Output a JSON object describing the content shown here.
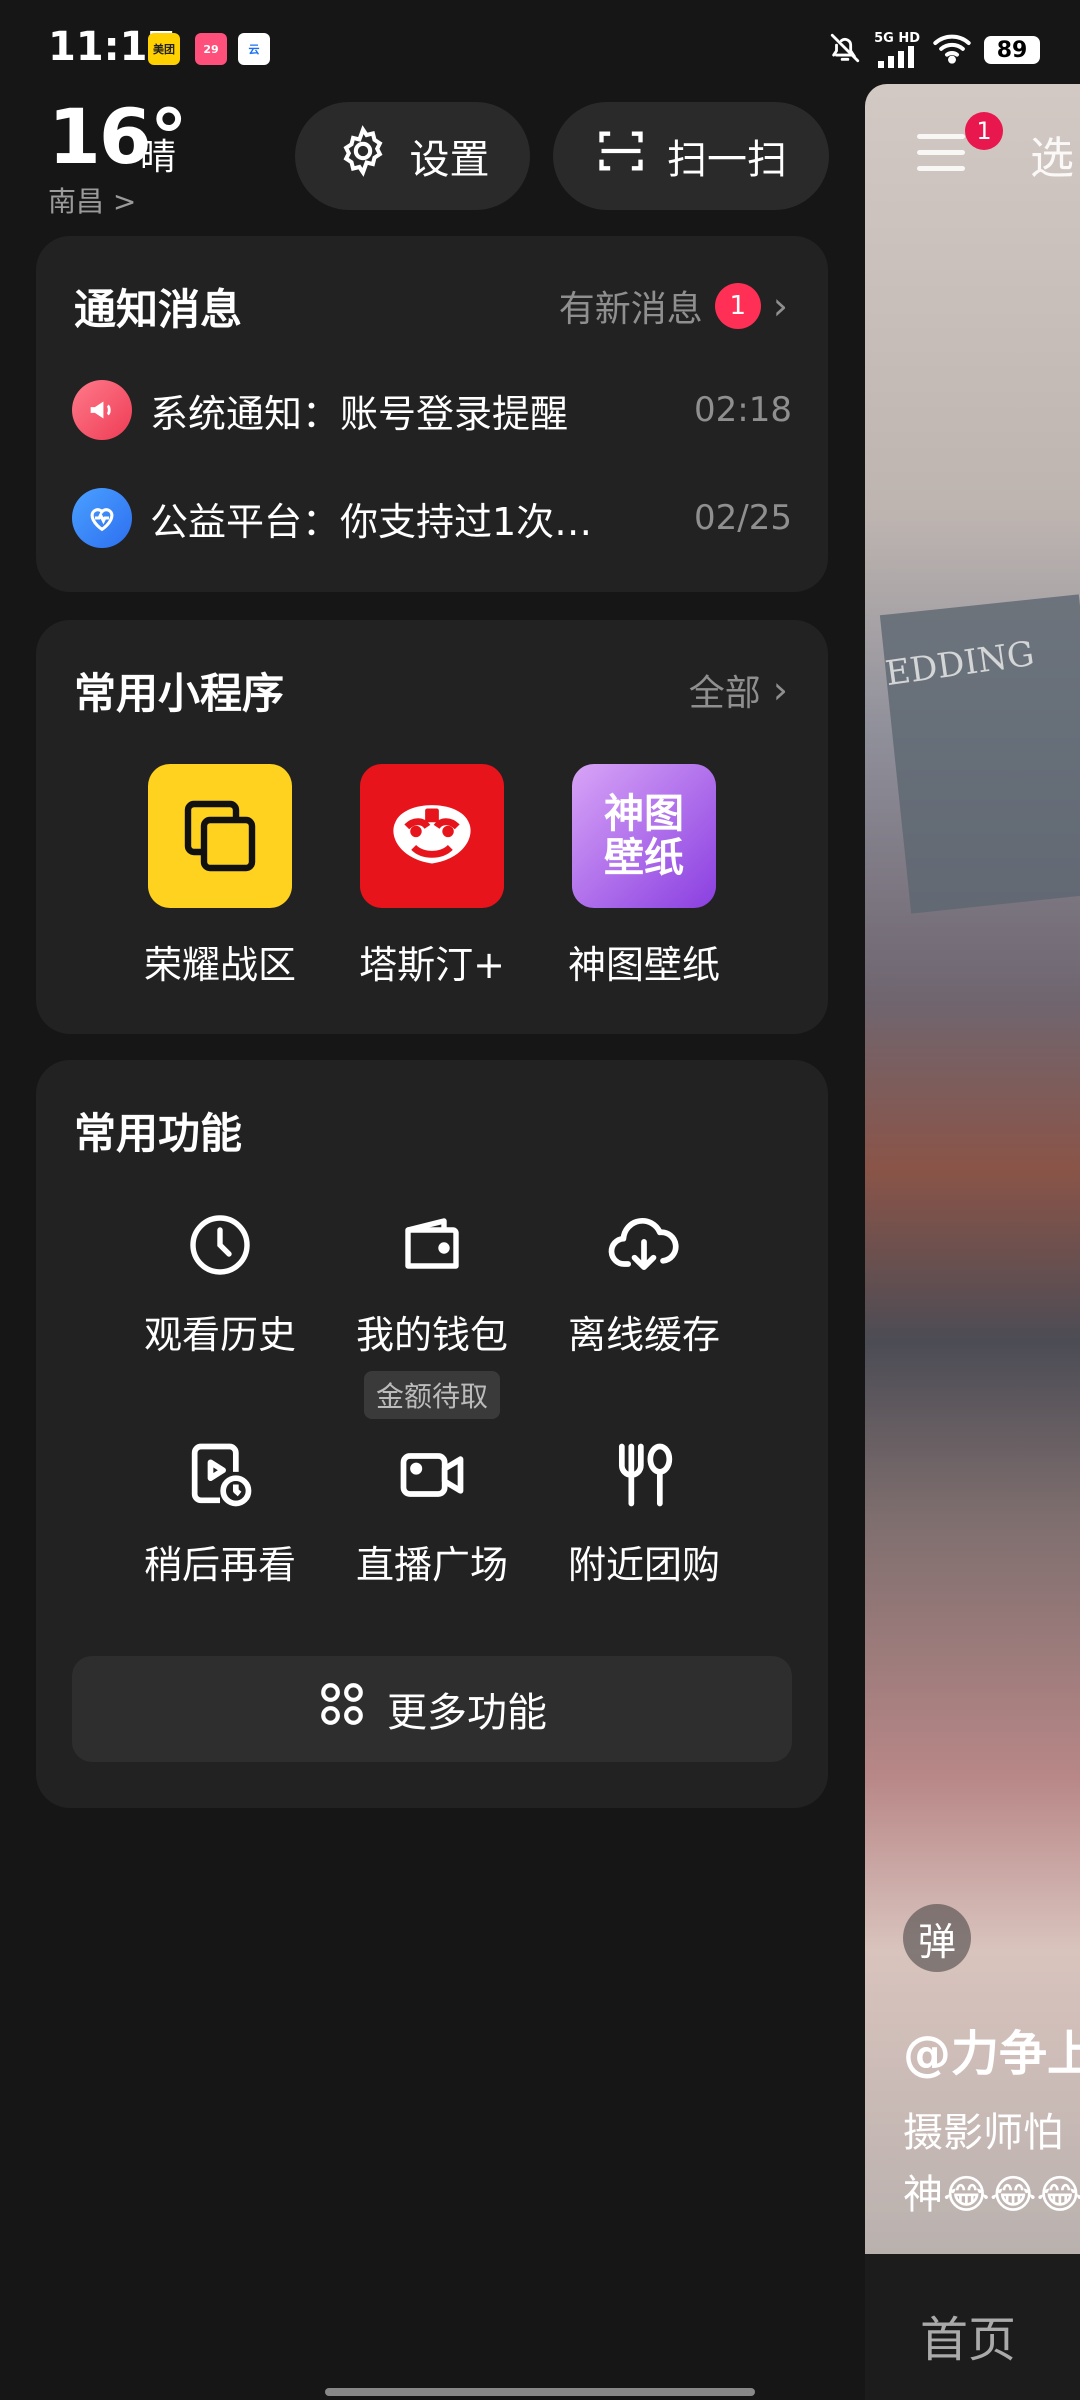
{
  "status_bar": {
    "time": "11:17",
    "app_badges": [
      "美团",
      "29",
      "云"
    ],
    "network": "5G HD",
    "battery": "89"
  },
  "weather": {
    "temp": "16°",
    "condition": "晴",
    "city": "南昌 >"
  },
  "top_buttons": {
    "settings": "设置",
    "scan": "扫一扫"
  },
  "notifications": {
    "title": "通知消息",
    "link": "有新消息",
    "count": "1",
    "items": [
      {
        "text": "系统通知：账号登录提醒",
        "time": "02:18"
      },
      {
        "text": "公益平台：你支持过1次…",
        "time": "02/25"
      }
    ]
  },
  "mini_apps": {
    "title": "常用小程序",
    "link": "全部",
    "items": [
      {
        "label": "荣耀战区"
      },
      {
        "label": "塔斯汀+"
      },
      {
        "label": "神图壁纸",
        "icon_text": [
          "神图",
          "壁纸"
        ]
      }
    ]
  },
  "functions": {
    "title": "常用功能",
    "items": [
      {
        "label": "观看历史",
        "icon": "clock-icon"
      },
      {
        "label": "我的钱包",
        "icon": "wallet-icon",
        "sub": "金额待取"
      },
      {
        "label": "离线缓存",
        "icon": "cloud-download-icon"
      },
      {
        "label": "稍后再看",
        "icon": "watch-later-icon"
      },
      {
        "label": "直播广场",
        "icon": "live-camera-icon"
      },
      {
        "label": "附近团购",
        "icon": "cutlery-icon"
      }
    ],
    "more": "更多功能"
  },
  "feed": {
    "badge": "1",
    "tab": "选",
    "sign_text": "EDDING",
    "danmu": "弹",
    "author": "@力争上",
    "desc": "摄影师怕",
    "desc2": "神😂😂😂",
    "nav_home": "首页"
  }
}
